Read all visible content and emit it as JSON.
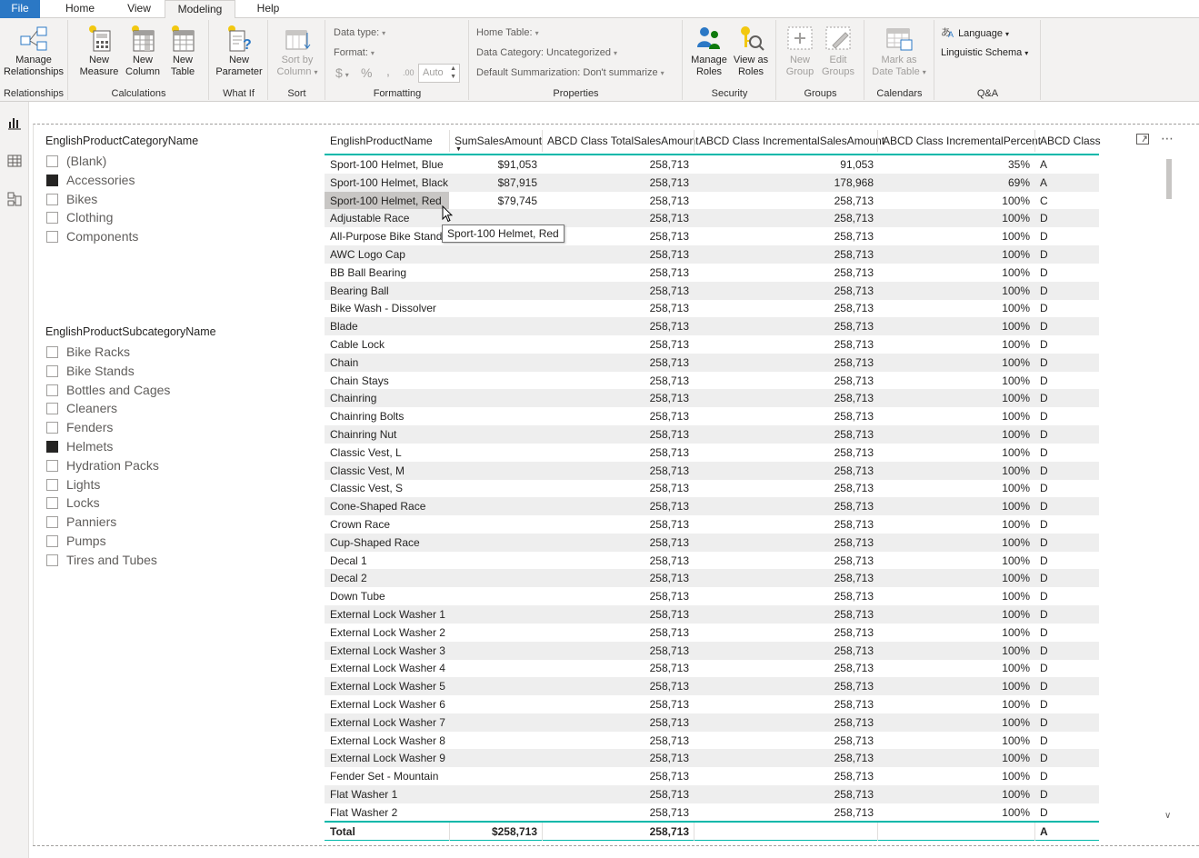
{
  "tabs": {
    "file": "File",
    "home": "Home",
    "view": "View",
    "modeling": "Modeling",
    "help": "Help"
  },
  "ribbon": {
    "relationships": {
      "group_label": "Relationships",
      "manage_line1": "Manage",
      "manage_line2": "Relationships"
    },
    "calculations": {
      "group_label": "Calculations",
      "new_measure_line1": "New",
      "new_measure_line2": "Measure",
      "new_column_line1": "New",
      "new_column_line2": "Column",
      "new_table_line1": "New",
      "new_table_line2": "Table"
    },
    "what_if": {
      "group_label": "What If",
      "new_parameter_line1": "New",
      "new_parameter_line2": "Parameter"
    },
    "sort": {
      "group_label": "Sort",
      "sort_by_line1": "Sort by",
      "sort_by_line2": "Column"
    },
    "formatting": {
      "group_label": "Formatting",
      "data_type": "Data type:",
      "format": "Format:",
      "currency": "$",
      "percent": "%",
      "comma": ",",
      "decimal": ".00",
      "auto": "Auto"
    },
    "properties": {
      "group_label": "Properties",
      "home_table": "Home Table:",
      "data_category": "Data Category: Uncategorized",
      "default_summarization": "Default Summarization: Don't summarize"
    },
    "security": {
      "group_label": "Security",
      "manage_roles_line1": "Manage",
      "manage_roles_line2": "Roles",
      "view_as_line1": "View as",
      "view_as_line2": "Roles"
    },
    "groups": {
      "group_label": "Groups",
      "new_group_line1": "New",
      "new_group_line2": "Group",
      "edit_groups_line1": "Edit",
      "edit_groups_line2": "Groups"
    },
    "calendars": {
      "group_label": "Calendars",
      "mark_line1": "Mark as",
      "mark_line2": "Date Table"
    },
    "qa": {
      "group_label": "Q&A",
      "language": "Language",
      "linguistic_schema": "Linguistic Schema"
    }
  },
  "slicer_category": {
    "title": "EnglishProductCategoryName",
    "items": [
      {
        "label": "(Blank)",
        "checked": false
      },
      {
        "label": "Accessories",
        "checked": true
      },
      {
        "label": "Bikes",
        "checked": false
      },
      {
        "label": "Clothing",
        "checked": false
      },
      {
        "label": "Components",
        "checked": false
      }
    ]
  },
  "slicer_subcategory": {
    "title": "EnglishProductSubcategoryName",
    "items": [
      {
        "label": "Bike Racks",
        "checked": false
      },
      {
        "label": "Bike Stands",
        "checked": false
      },
      {
        "label": "Bottles and Cages",
        "checked": false
      },
      {
        "label": "Cleaners",
        "checked": false
      },
      {
        "label": "Fenders",
        "checked": false
      },
      {
        "label": "Helmets",
        "checked": true
      },
      {
        "label": "Hydration Packs",
        "checked": false
      },
      {
        "label": "Lights",
        "checked": false
      },
      {
        "label": "Locks",
        "checked": false
      },
      {
        "label": "Panniers",
        "checked": false
      },
      {
        "label": "Pumps",
        "checked": false
      },
      {
        "label": "Tires and Tubes",
        "checked": false
      }
    ]
  },
  "table": {
    "columns": [
      "EnglishProductName",
      "SumSalesAmount",
      "ABCD Class TotalSalesAmount",
      "ABCD Class IncrementalSalesAmount",
      "ABCD Class IncrementalPercent",
      "ABCD Class"
    ],
    "rows": [
      [
        "Sport-100 Helmet, Blue",
        "$91,053",
        "258,713",
        "91,053",
        "35%",
        "A"
      ],
      [
        "Sport-100 Helmet, Black",
        "$87,915",
        "258,713",
        "178,968",
        "69%",
        "A"
      ],
      [
        "Sport-100 Helmet, Red",
        "$79,745",
        "258,713",
        "258,713",
        "100%",
        "C"
      ],
      [
        "Adjustable Race",
        "",
        "258,713",
        "258,713",
        "100%",
        "D"
      ],
      [
        "All-Purpose Bike Stand",
        "",
        "258,713",
        "258,713",
        "100%",
        "D"
      ],
      [
        "AWC Logo Cap",
        "",
        "258,713",
        "258,713",
        "100%",
        "D"
      ],
      [
        "BB Ball Bearing",
        "",
        "258,713",
        "258,713",
        "100%",
        "D"
      ],
      [
        "Bearing Ball",
        "",
        "258,713",
        "258,713",
        "100%",
        "D"
      ],
      [
        "Bike Wash - Dissolver",
        "",
        "258,713",
        "258,713",
        "100%",
        "D"
      ],
      [
        "Blade",
        "",
        "258,713",
        "258,713",
        "100%",
        "D"
      ],
      [
        "Cable Lock",
        "",
        "258,713",
        "258,713",
        "100%",
        "D"
      ],
      [
        "Chain",
        "",
        "258,713",
        "258,713",
        "100%",
        "D"
      ],
      [
        "Chain Stays",
        "",
        "258,713",
        "258,713",
        "100%",
        "D"
      ],
      [
        "Chainring",
        "",
        "258,713",
        "258,713",
        "100%",
        "D"
      ],
      [
        "Chainring Bolts",
        "",
        "258,713",
        "258,713",
        "100%",
        "D"
      ],
      [
        "Chainring Nut",
        "",
        "258,713",
        "258,713",
        "100%",
        "D"
      ],
      [
        "Classic Vest, L",
        "",
        "258,713",
        "258,713",
        "100%",
        "D"
      ],
      [
        "Classic Vest, M",
        "",
        "258,713",
        "258,713",
        "100%",
        "D"
      ],
      [
        "Classic Vest, S",
        "",
        "258,713",
        "258,713",
        "100%",
        "D"
      ],
      [
        "Cone-Shaped Race",
        "",
        "258,713",
        "258,713",
        "100%",
        "D"
      ],
      [
        "Crown Race",
        "",
        "258,713",
        "258,713",
        "100%",
        "D"
      ],
      [
        "Cup-Shaped Race",
        "",
        "258,713",
        "258,713",
        "100%",
        "D"
      ],
      [
        "Decal 1",
        "",
        "258,713",
        "258,713",
        "100%",
        "D"
      ],
      [
        "Decal 2",
        "",
        "258,713",
        "258,713",
        "100%",
        "D"
      ],
      [
        "Down Tube",
        "",
        "258,713",
        "258,713",
        "100%",
        "D"
      ],
      [
        "External Lock Washer 1",
        "",
        "258,713",
        "258,713",
        "100%",
        "D"
      ],
      [
        "External Lock Washer 2",
        "",
        "258,713",
        "258,713",
        "100%",
        "D"
      ],
      [
        "External Lock Washer 3",
        "",
        "258,713",
        "258,713",
        "100%",
        "D"
      ],
      [
        "External Lock Washer 4",
        "",
        "258,713",
        "258,713",
        "100%",
        "D"
      ],
      [
        "External Lock Washer 5",
        "",
        "258,713",
        "258,713",
        "100%",
        "D"
      ],
      [
        "External Lock Washer 6",
        "",
        "258,713",
        "258,713",
        "100%",
        "D"
      ],
      [
        "External Lock Washer 7",
        "",
        "258,713",
        "258,713",
        "100%",
        "D"
      ],
      [
        "External Lock Washer 8",
        "",
        "258,713",
        "258,713",
        "100%",
        "D"
      ],
      [
        "External Lock Washer 9",
        "",
        "258,713",
        "258,713",
        "100%",
        "D"
      ],
      [
        "Fender Set - Mountain",
        "",
        "258,713",
        "258,713",
        "100%",
        "D"
      ],
      [
        "Flat Washer 1",
        "",
        "258,713",
        "258,713",
        "100%",
        "D"
      ],
      [
        "Flat Washer 2",
        "",
        "258,713",
        "258,713",
        "100%",
        "D"
      ]
    ],
    "highlighted_row": 2,
    "total": [
      "Total",
      "$258,713",
      "258,713",
      "",
      "",
      "A"
    ]
  },
  "tooltip": "Sport-100 Helmet, Red",
  "colors": {
    "accent": "#01b8aa",
    "file_tab": "#2b78c5",
    "row_alt": "#eeeeee"
  }
}
